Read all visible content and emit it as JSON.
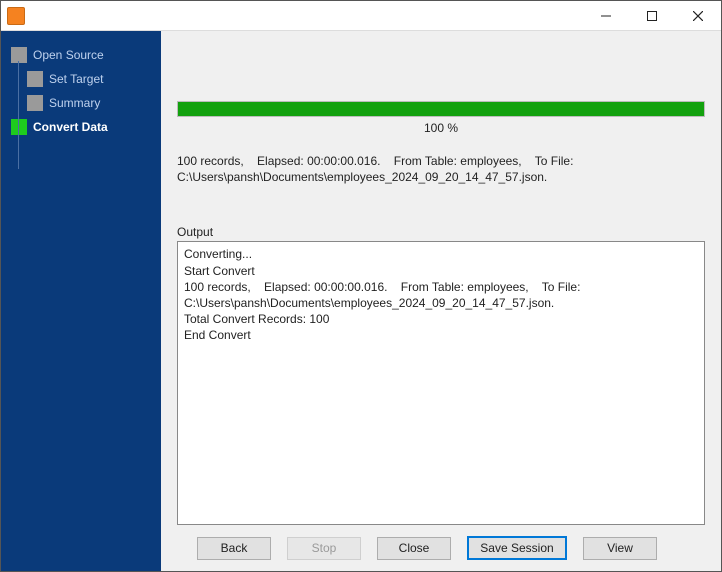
{
  "window": {
    "title": ""
  },
  "sidebar": {
    "items": [
      {
        "label": "Open Source",
        "active": false,
        "child": false
      },
      {
        "label": "Set Target",
        "active": false,
        "child": true
      },
      {
        "label": "Summary",
        "active": false,
        "child": true
      },
      {
        "label": "Convert Data",
        "active": true,
        "child": false
      }
    ]
  },
  "progress": {
    "percent_label": "100 %",
    "percent_value": 100
  },
  "summary_text": "100 records,    Elapsed: 00:00:00.016.    From Table: employees,    To File: C:\\Users\\pansh\\Documents\\employees_2024_09_20_14_47_57.json.",
  "output": {
    "label": "Output",
    "text": "Converting...\nStart Convert\n100 records,    Elapsed: 00:00:00.016.    From Table: employees,    To File: C:\\Users\\pansh\\Documents\\employees_2024_09_20_14_47_57.json.\nTotal Convert Records: 100\nEnd Convert"
  },
  "footer": {
    "back": "Back",
    "stop": "Stop",
    "close": "Close",
    "save_session": "Save Session",
    "view": "View"
  }
}
